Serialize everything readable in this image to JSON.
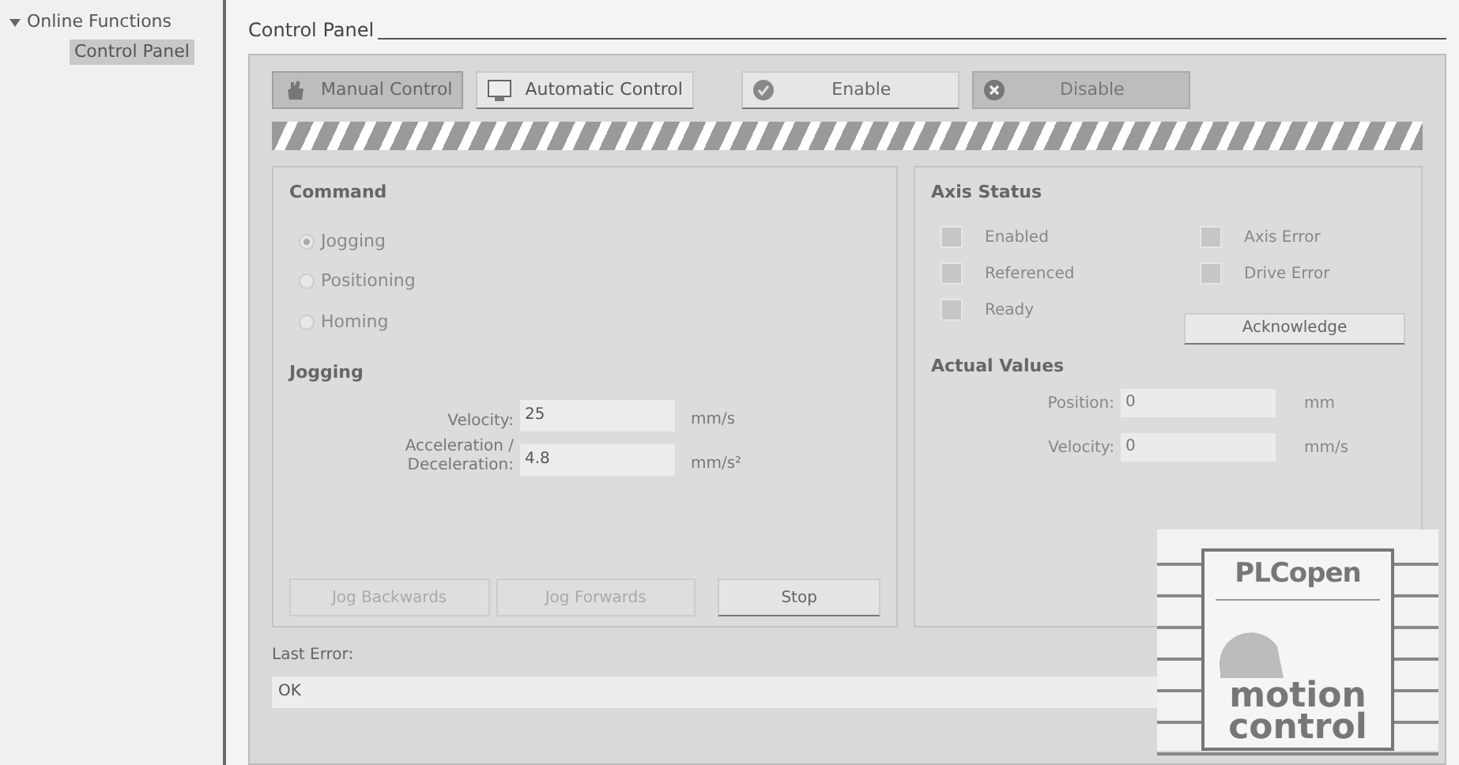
{
  "tree": [
    {
      "label": "Online Functions",
      "expanded": true,
      "children": [
        {
          "label": "Control Panel",
          "selected": true
        }
      ]
    }
  ],
  "title": "Control Panel",
  "mode_buttons": [
    {
      "kind": "hand",
      "label": "Manual Control",
      "selected": true
    },
    {
      "kind": "monitor",
      "label": "Automatic Control",
      "selected": false
    }
  ],
  "power_buttons": [
    {
      "kind": "check",
      "label": "Enable",
      "selected": false
    },
    {
      "kind": "cross",
      "label": "Disable",
      "selected": true
    }
  ],
  "command": {
    "title": "Command",
    "options": [
      {
        "label": "Jogging",
        "selected": true
      },
      {
        "label": "Positioning",
        "selected": false
      },
      {
        "label": "Homing",
        "selected": false
      }
    ]
  },
  "jogging": {
    "title": "Jogging",
    "fields": [
      {
        "label": "Velocity:",
        "value": "25",
        "unit": "mm/s"
      },
      {
        "label": "Acceleration / Deceleration:",
        "value": "4.8",
        "unit": "mm/s²"
      }
    ],
    "buttons": [
      {
        "label": "Jog Backwards",
        "disabled": true
      },
      {
        "label": "Jog Forwards",
        "disabled": true
      },
      {
        "label": "Stop",
        "disabled": false
      }
    ]
  },
  "axis_status": {
    "title": "Axis Status",
    "indicators": [
      {
        "label": "Enabled",
        "on": false
      },
      {
        "label": "Axis Error",
        "on": false
      },
      {
        "label": "Referenced",
        "on": false
      },
      {
        "label": "Drive Error",
        "on": false
      },
      {
        "label": "Ready",
        "on": false
      }
    ],
    "button": "Acknowledge"
  },
  "actual_values": {
    "title": "Actual Values",
    "fields": [
      {
        "label": "Position:",
        "value": "0",
        "unit": "mm"
      },
      {
        "label": "Velocity:",
        "value": "0",
        "unit": "mm/s"
      }
    ]
  },
  "last_error": {
    "label": "Last Error:",
    "value": "OK"
  },
  "logo": {
    "top": "PLCopen",
    "bottom": "motion control"
  }
}
